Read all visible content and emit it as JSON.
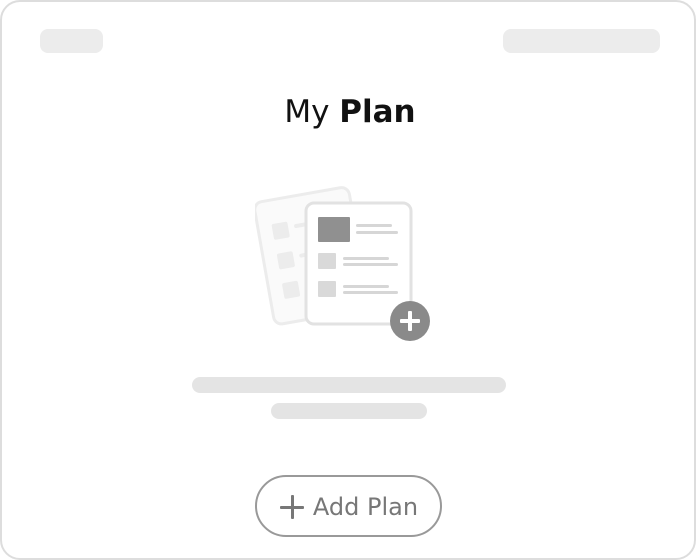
{
  "page": {
    "title_light": "My",
    "title_bold": "Plan"
  },
  "illustration": {
    "icon": "empty-plan-documents-icon",
    "badge_icon": "plus-circle-icon",
    "accent_color": "#8a8a8a"
  },
  "actions": {
    "add_plan_label": "Add Plan",
    "add_plan_icon": "plus-icon"
  },
  "colors": {
    "skeleton": "#ececec",
    "button_border": "#999999",
    "button_text": "#777777"
  }
}
